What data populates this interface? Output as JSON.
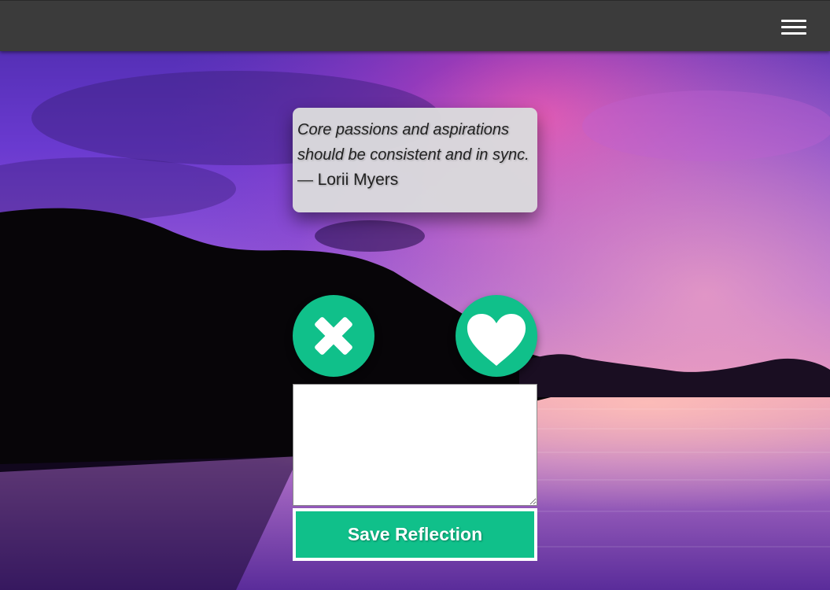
{
  "navbar": {
    "menu_icon": "hamburger-menu-icon"
  },
  "quote": {
    "text": "Core passions and aspirations should be consistent and in sync.",
    "dash": "—",
    "author": "Lorii Myers"
  },
  "actions": {
    "reject_icon": "close-x-icon",
    "like_icon": "heart-icon"
  },
  "reflection": {
    "value": "",
    "placeholder": ""
  },
  "save_button": {
    "label": "Save Reflection"
  },
  "colors": {
    "accent": "#10c08a",
    "topbar": "#3b3b3b",
    "card": "#dadadc"
  }
}
